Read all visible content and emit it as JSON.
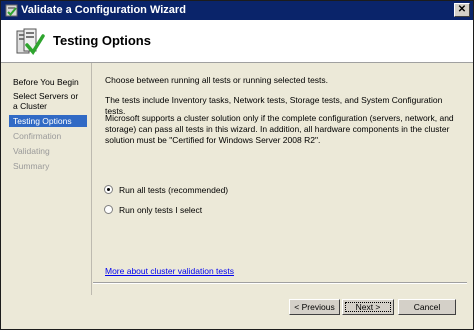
{
  "window": {
    "title": "Validate a Configuration Wizard"
  },
  "header": {
    "title": "Testing Options"
  },
  "steps": [
    {
      "label": "Before You Begin",
      "state": "done"
    },
    {
      "label": "Select Servers or a Cluster",
      "state": "done"
    },
    {
      "label": "Testing Options",
      "state": "active"
    },
    {
      "label": "Confirmation",
      "state": "pending"
    },
    {
      "label": "Validating",
      "state": "pending"
    },
    {
      "label": "Summary",
      "state": "pending"
    }
  ],
  "content": {
    "intro": "Choose between running all tests or running selected tests.",
    "tests_info": "The tests include Inventory tasks, Network tests, Storage tests, and System Configuration tests.",
    "support_info": "Microsoft supports a cluster solution only if the complete configuration (servers, network, and storage) can pass all tests in this wizard. In addition, all hardware components in the cluster solution must be \"Certified for Windows Server 2008 R2\".",
    "options": [
      {
        "label": "Run all tests (recommended)",
        "selected": true
      },
      {
        "label": "Run only tests I select",
        "selected": false
      }
    ],
    "link": "More about cluster validation tests"
  },
  "buttons": {
    "previous": "< Previous",
    "next": "Next >",
    "cancel": "Cancel"
  },
  "colors": {
    "titlebar": "#0a246a",
    "selection": "#316ac5",
    "link": "#0000ee",
    "face": "#ece9d8"
  }
}
